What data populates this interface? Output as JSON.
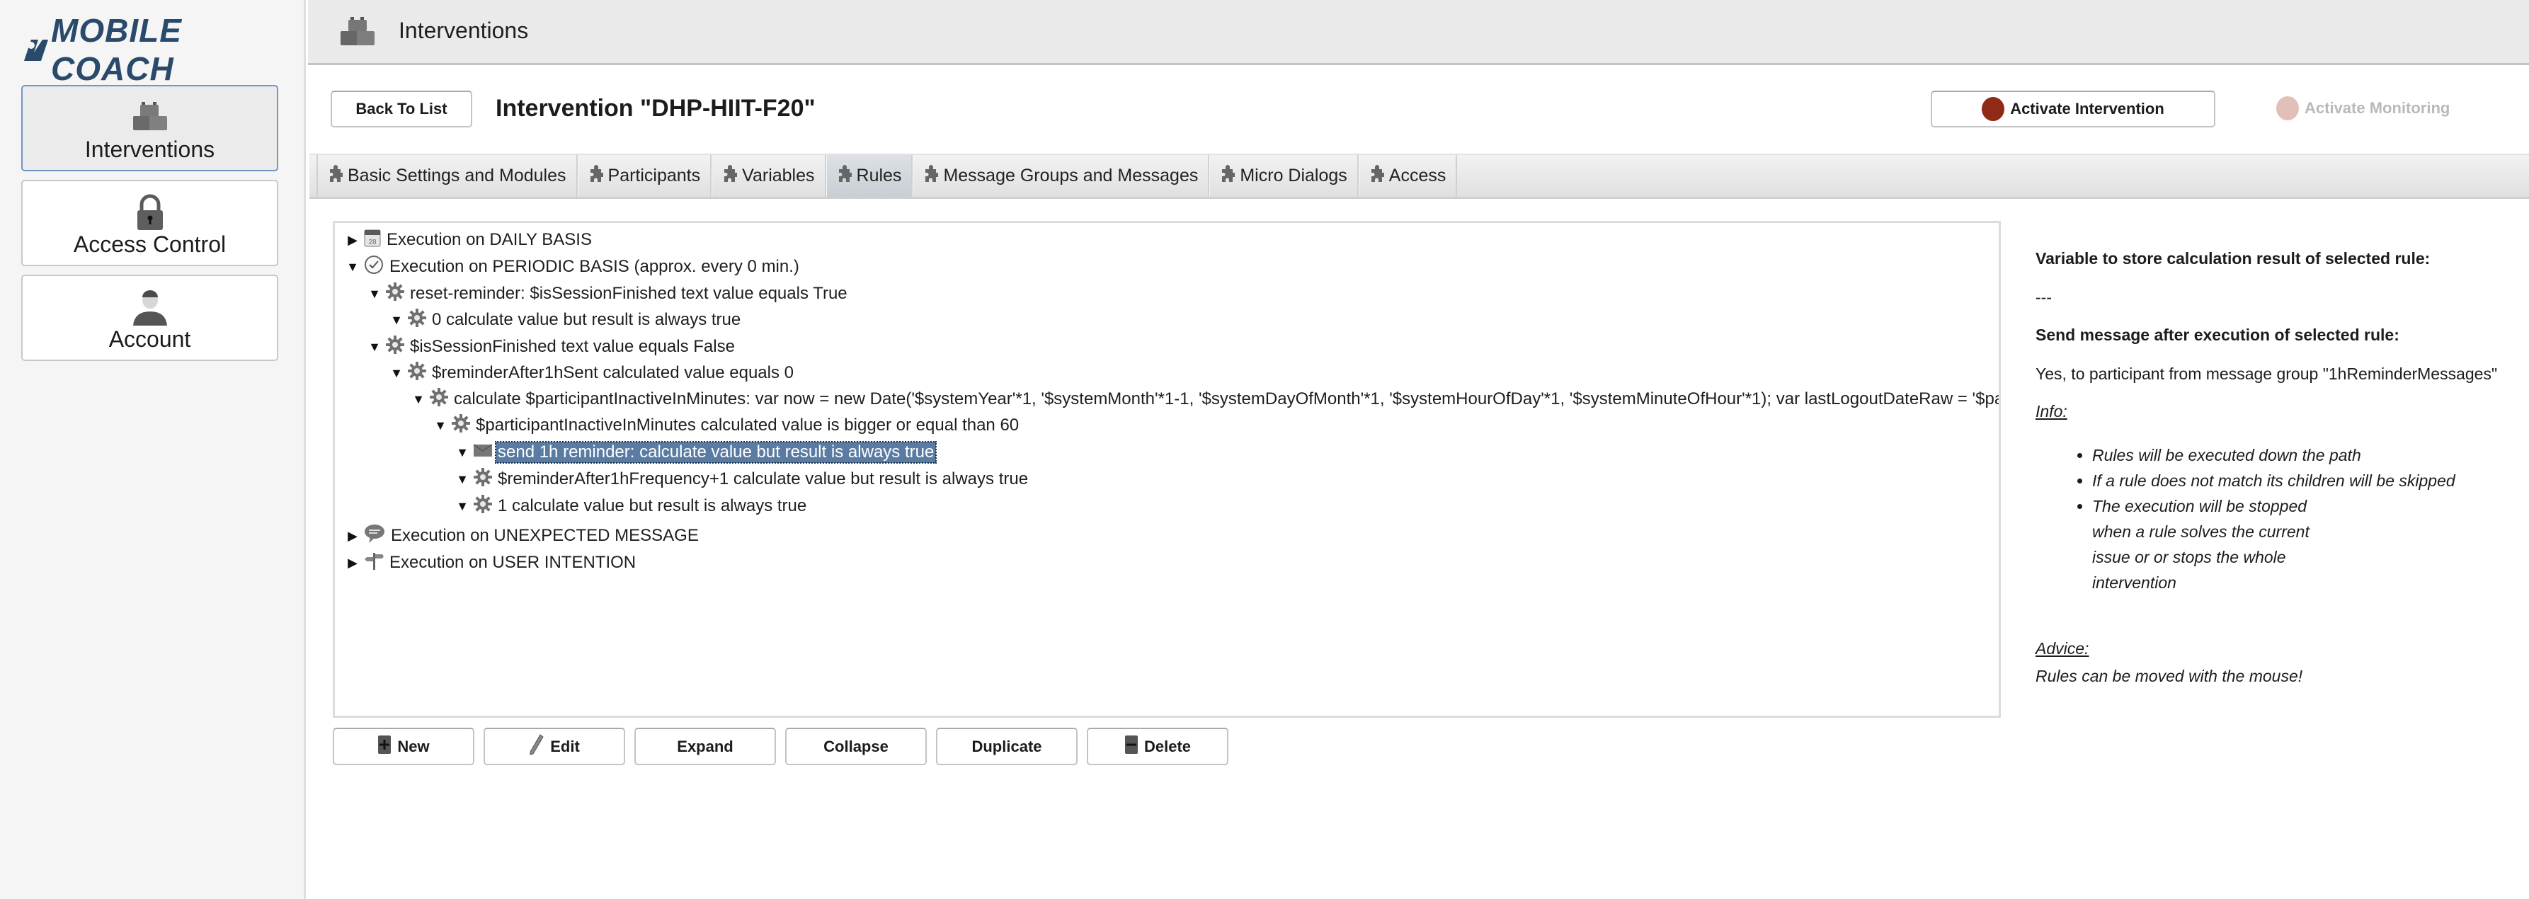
{
  "app": {
    "logo_text": "MOBILE COACH",
    "logo_mark": "M"
  },
  "sidebar": {
    "items": [
      {
        "label": "Interventions",
        "icon": "blocks-icon",
        "selected": true
      },
      {
        "label": "Access Control",
        "icon": "lock-icon",
        "selected": false
      },
      {
        "label": "Account",
        "icon": "user-icon",
        "selected": false
      }
    ]
  },
  "header": {
    "section_title": "Interventions",
    "back_label": "Back To List",
    "page_title": "Intervention \"DHP-HIIT-F20\"",
    "activate_intervention_label": "Activate Intervention",
    "activate_monitoring_label": "Activate Monitoring",
    "colors": {
      "status_active": "#8e2a15",
      "status_disabled": "#e2bfb9",
      "selection": "#5a7ba2"
    }
  },
  "tabs": [
    {
      "label": "Basic Settings and Modules",
      "active": false
    },
    {
      "label": "Participants",
      "active": false
    },
    {
      "label": "Variables",
      "active": false
    },
    {
      "label": "Rules",
      "active": true
    },
    {
      "label": "Message Groups and Messages",
      "active": false
    },
    {
      "label": "Micro Dialogs",
      "active": false
    },
    {
      "label": "Access",
      "active": false
    }
  ],
  "tree": {
    "rows": [
      {
        "label": "Execution on DAILY BASIS",
        "icon": "calendar-icon",
        "expanded": false,
        "selected": false
      },
      {
        "label": "Execution on PERIODIC BASIS (approx. every 0 min.)",
        "icon": "clock-icon",
        "expanded": true,
        "selected": false
      },
      {
        "label": "reset-reminder: $isSessionFinished text value equals True",
        "icon": "gear-icon",
        "expanded": true,
        "selected": false
      },
      {
        "label": "0 calculate value but result is always true",
        "icon": "gear-icon",
        "expanded": true,
        "selected": false
      },
      {
        "label": "$isSessionFinished text value equals False",
        "icon": "gear-icon",
        "expanded": true,
        "selected": false
      },
      {
        "label": "$reminderAfter1hSent calculated value equals 0",
        "icon": "gear-icon",
        "expanded": true,
        "selected": false
      },
      {
        "label": "calculate $participantInactiveInMinutes: var now = new Date('$systemYear'*1, '$systemMonth'*1-1, '$systemDayOfMonth'*1, '$systemHourOfDay'*1, '$systemMinuteOfHour'*1); var lastLogoutDateRaw = '$pa",
        "icon": "gear-icon",
        "expanded": true,
        "selected": false
      },
      {
        "label": "$participantInactiveInMinutes calculated value is bigger or equal than 60",
        "icon": "gear-icon",
        "expanded": true,
        "selected": false
      },
      {
        "label": "send 1h reminder: calculate value but result is always true",
        "icon": "envelope-icon",
        "expanded": true,
        "selected": true
      },
      {
        "label": "$reminderAfter1hFrequency+1 calculate value but result is always true",
        "icon": "gear-icon",
        "expanded": true,
        "selected": false
      },
      {
        "label": "1 calculate value but result is always true",
        "icon": "gear-icon",
        "expanded": true,
        "selected": false
      },
      {
        "label": "Execution on UNEXPECTED MESSAGE",
        "icon": "speech-bubble-icon",
        "expanded": false,
        "selected": false
      },
      {
        "label": "Execution on USER INTENTION",
        "icon": "signpost-icon",
        "expanded": false,
        "selected": false
      }
    ]
  },
  "actions": {
    "new": "New",
    "edit": "Edit",
    "expand": "Expand",
    "collapse": "Collapse",
    "duplicate": "Duplicate",
    "delete": "Delete"
  },
  "info_panel": {
    "variable_heading": "Variable to store calculation result of selected rule:",
    "variable_value": "---",
    "send_heading": "Send message after execution of selected rule:",
    "send_value": "Yes, to participant from message group \"1hReminderMessages\"",
    "info_label": "Info:",
    "info_items": [
      "Rules will be executed down the path",
      "If a rule does not match its children will be skipped",
      "The execution will be stopped when a rule solves the current issue or or stops the whole intervention"
    ],
    "advice_label": "Advice:",
    "advice_text": "Rules can be moved with the mouse!"
  }
}
